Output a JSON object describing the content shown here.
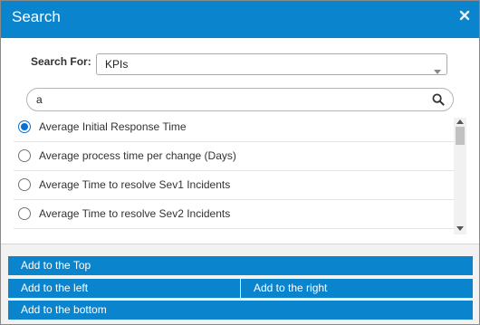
{
  "dialog": {
    "title": "Search"
  },
  "search_for": {
    "label": "Search For:",
    "selected": "KPIs"
  },
  "search": {
    "value": "a"
  },
  "results": {
    "items": [
      {
        "label": "Average Initial Response Time",
        "selected": true
      },
      {
        "label": "Average process time per change (Days)",
        "selected": false
      },
      {
        "label": "Average Time to resolve Sev1 Incidents",
        "selected": false
      },
      {
        "label": "Average Time to resolve Sev2 Incidents",
        "selected": false
      },
      {
        "label": "",
        "selected": false
      }
    ]
  },
  "actions": {
    "add_top": "Add to the Top",
    "add_left": "Add to the left",
    "add_right": "Add to the right",
    "add_bottom": "Add to the bottom"
  },
  "colors": {
    "accent": "#0a84cc",
    "radio_selected": "#0a6fd0"
  },
  "icons": {
    "close": "close-icon",
    "dropdown": "chevron-down-icon",
    "search": "search-icon"
  }
}
